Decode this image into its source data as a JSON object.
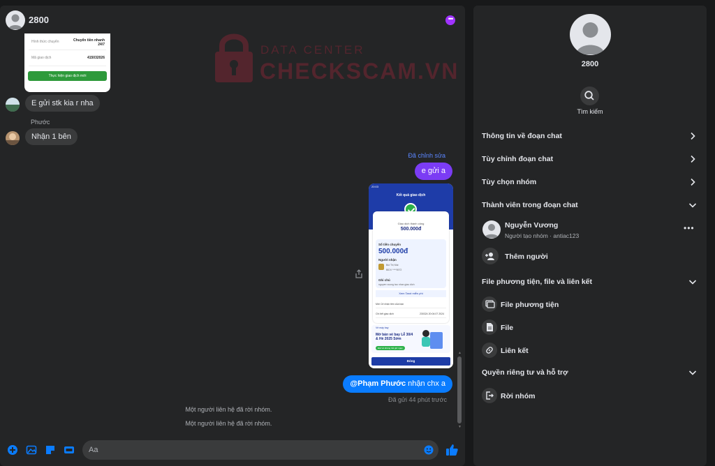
{
  "chat": {
    "title": "2800",
    "thumb_top": {
      "rows": [
        {
          "key": "Hình thức chuyển",
          "value": "Chuyển tiền nhanh 24/7"
        },
        {
          "key": "Mã giao dịch",
          "value": "415032026"
        }
      ],
      "button": "Thực hiện giao dịch mới"
    },
    "watermark": {
      "line1": "DATA CENTER",
      "line2": "CHECKSCAM.VN"
    },
    "messages": {
      "m1": "E gửi stk kia r nha",
      "sender2": "Phước",
      "m2": "Nhận 1 bên",
      "edited_label": "Đã chỉnh sửa",
      "m3": "e gửi a",
      "m4_mention": "@Phạm Phước",
      "m4_text": " nhận chx a",
      "sent_time": "Đã gửi 44 phút trước"
    },
    "phone": {
      "status": "20:03",
      "title": "Kết quả giao dịch",
      "success": "Giao dịch thành công",
      "amount_small": "500.000đ",
      "transfer_label": "Số tiền chuyển",
      "amount_big": "500.000đ",
      "receiver_label": "Người nhận",
      "receiver_name": "Bùi Thị Mai",
      "receiver_acct": "BIDV ****5972",
      "note_label": "Ghi chú",
      "note_text": "nguyen vuong tao nhan giao dich",
      "free_link": "Xem Tarot miễn phí",
      "row1": "Mời Cê nhận tiền của bạn",
      "row2": "Chi tiết giao dịch",
      "row2_value": "230324 20:04:07 2024",
      "banner_small": "Vé máy bay",
      "banner_title": "Mở bán vé bay Lễ 30/4 & Hè 2025 Sớm",
      "banner_tag": "Đặt Vé không thể giữ ngay",
      "done": "Đóng"
    },
    "system": [
      "Một người liên hệ đã rời nhóm.",
      "Một người liên hệ đã rời nhóm."
    ],
    "composer": {
      "placeholder": "Aa"
    }
  },
  "info": {
    "name": "2800",
    "search_label": "Tìm kiếm",
    "sections": [
      "Thông tin về đoạn chat",
      "Tùy chỉnh đoạn chat",
      "Tùy chọn nhóm",
      "Thành viên trong đoạn chat"
    ],
    "member": {
      "name": "Nguyễn Vương",
      "role": "Người tạo nhóm · antiac123"
    },
    "add_person": "Thêm người",
    "media_section": "File phương tiện, file và liên kết",
    "media_items": [
      "File phương tiện",
      "File",
      "Liên kết"
    ],
    "privacy_section": "Quyền riêng tư và hỗ trợ",
    "leave": "Rời nhóm"
  },
  "colors": {
    "accent": "#0a7cff",
    "bubble_out_purple": "#7b3cf4",
    "panel": "#242526",
    "background": "#18191a"
  }
}
